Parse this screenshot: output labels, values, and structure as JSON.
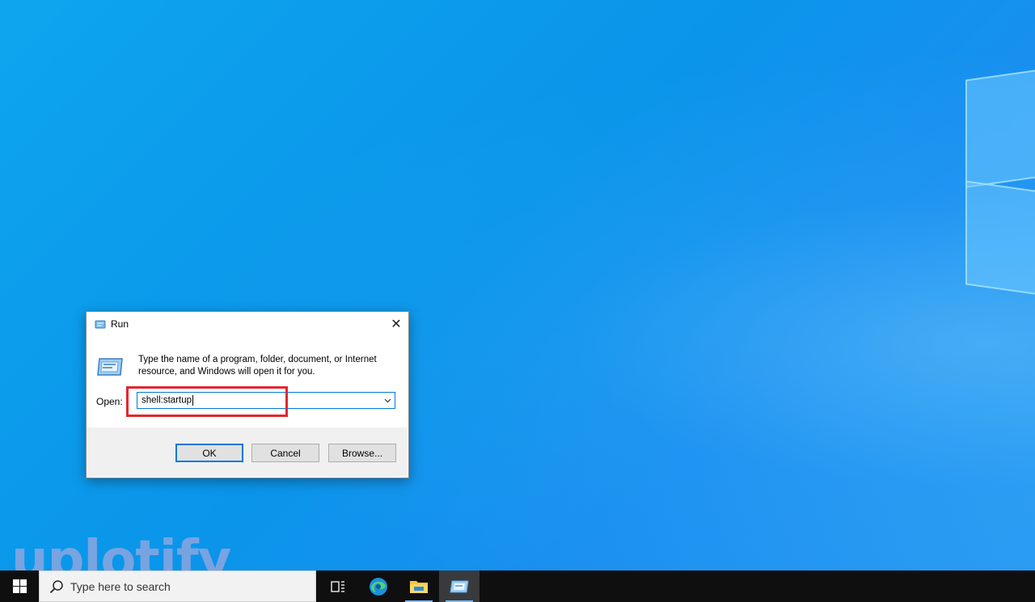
{
  "run_dialog": {
    "title": "Run",
    "close_glyph": "✕",
    "description": "Type the name of a program, folder, document, or Internet resource, and Windows will open it for you.",
    "open_label": "Open:",
    "open_value": "shell:startup",
    "buttons": {
      "ok": "OK",
      "cancel": "Cancel",
      "browse": "Browse..."
    },
    "highlight_color": "#e3262f"
  },
  "watermark": {
    "text": "uplotify"
  },
  "taskbar": {
    "search_placeholder": "Type here to search",
    "icons": [
      "windows-start-icon",
      "search-icon",
      "task-view-icon",
      "edge-icon",
      "file-explorer-icon",
      "run-icon"
    ]
  },
  "colors": {
    "accent": "#0078d7",
    "taskbar_bg": "#0f0f10",
    "desktop_bg": "#0a95ea"
  }
}
